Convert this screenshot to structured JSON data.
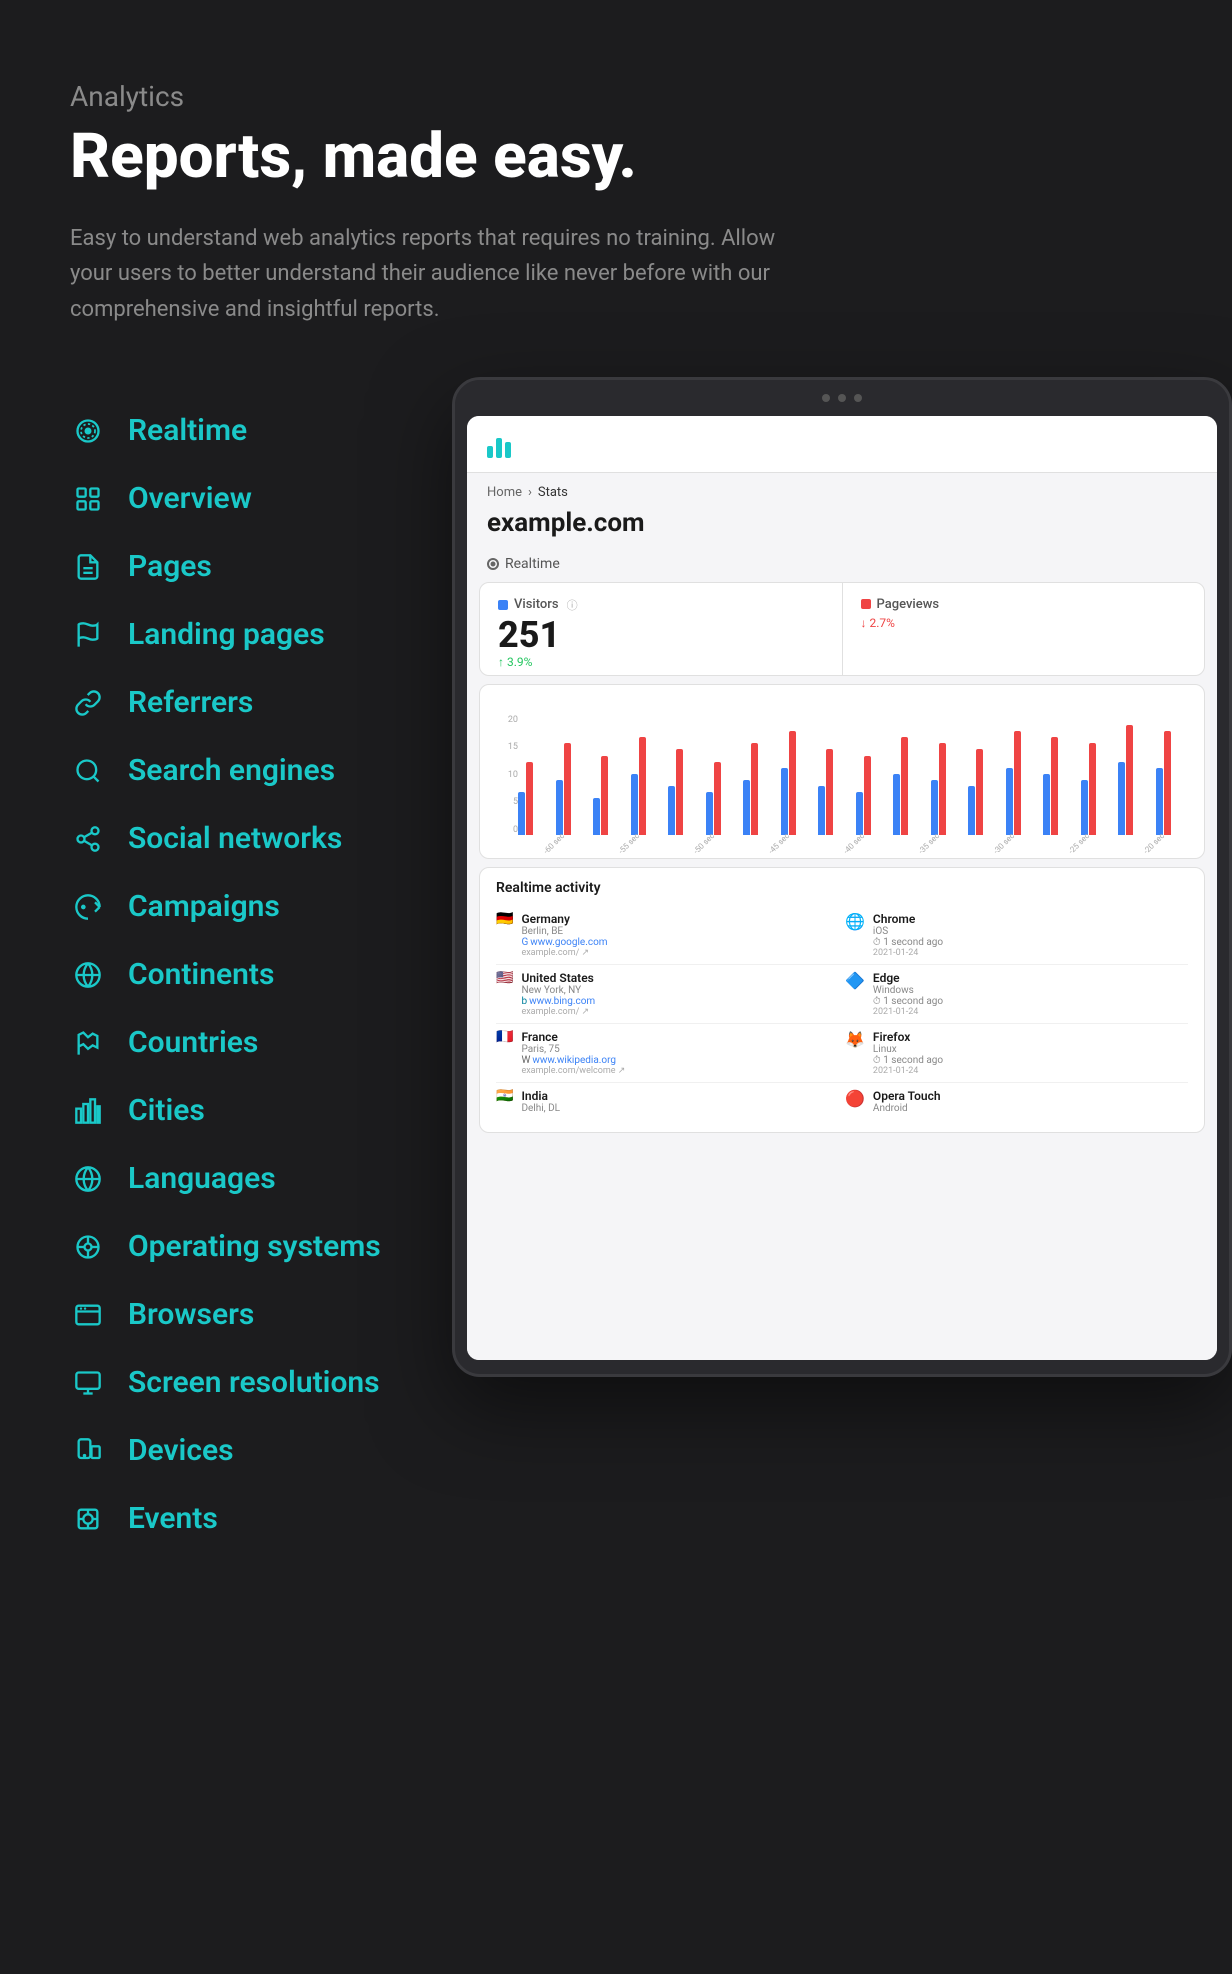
{
  "page": {
    "background": "#1c1c1e"
  },
  "header": {
    "analytics_label": "Analytics",
    "main_title": "Reports, made easy.",
    "description": "Easy to understand web analytics reports that requires no training. Allow your users to better understand their audience like never before with our comprehensive and insightful reports."
  },
  "nav": {
    "items": [
      {
        "id": "realtime",
        "label": "Realtime",
        "icon": "realtime-icon"
      },
      {
        "id": "overview",
        "label": "Overview",
        "icon": "overview-icon"
      },
      {
        "id": "pages",
        "label": "Pages",
        "icon": "pages-icon"
      },
      {
        "id": "landing-pages",
        "label": "Landing pages",
        "icon": "landing-pages-icon"
      },
      {
        "id": "referrers",
        "label": "Referrers",
        "icon": "referrers-icon"
      },
      {
        "id": "search-engines",
        "label": "Search engines",
        "icon": "search-engines-icon"
      },
      {
        "id": "social-networks",
        "label": "Social networks",
        "icon": "social-networks-icon"
      },
      {
        "id": "campaigns",
        "label": "Campaigns",
        "icon": "campaigns-icon"
      },
      {
        "id": "continents",
        "label": "Continents",
        "icon": "continents-icon"
      },
      {
        "id": "countries",
        "label": "Countries",
        "icon": "countries-icon"
      },
      {
        "id": "cities",
        "label": "Cities",
        "icon": "cities-icon"
      },
      {
        "id": "languages",
        "label": "Languages",
        "icon": "languages-icon"
      },
      {
        "id": "operating-systems",
        "label": "Operating systems",
        "icon": "os-icon"
      },
      {
        "id": "browsers",
        "label": "Browsers",
        "icon": "browsers-icon"
      },
      {
        "id": "screen-resolutions",
        "label": "Screen resolutions",
        "icon": "screen-icon"
      },
      {
        "id": "devices",
        "label": "Devices",
        "icon": "devices-icon"
      },
      {
        "id": "events",
        "label": "Events",
        "icon": "events-icon"
      }
    ]
  },
  "dashboard": {
    "breadcrumb_home": "Home",
    "breadcrumb_stats": "Stats",
    "site": "example.com",
    "realtime_tab": "Realtime",
    "visitors_label": "Visitors",
    "visitors_value": "251",
    "visitors_change": "3.9%",
    "visitors_change_dir": "up",
    "pageviews_label": "Pageviews",
    "pageviews_change": "2.7%",
    "pageviews_change_dir": "down",
    "activity_title": "Realtime activity",
    "chart": {
      "y_labels": [
        "20",
        "15",
        "10",
        "5",
        "0"
      ],
      "x_labels": [
        "-60 sec",
        "-55 sec",
        "-50 sec",
        "-45 sec",
        "-40 sec",
        "-35 sec",
        "-30 sec",
        "-25 sec",
        "-20 sec"
      ],
      "bars": [
        {
          "visitors": 35,
          "pageviews": 60
        },
        {
          "visitors": 45,
          "pageviews": 75
        },
        {
          "visitors": 30,
          "pageviews": 65
        },
        {
          "visitors": 50,
          "pageviews": 80
        },
        {
          "visitors": 40,
          "pageviews": 70
        },
        {
          "visitors": 35,
          "pageviews": 60
        },
        {
          "visitors": 45,
          "pageviews": 75
        },
        {
          "visitors": 55,
          "pageviews": 85
        },
        {
          "visitors": 40,
          "pageviews": 70
        },
        {
          "visitors": 35,
          "pageviews": 65
        },
        {
          "visitors": 50,
          "pageviews": 80
        },
        {
          "visitors": 45,
          "pageviews": 75
        },
        {
          "visitors": 40,
          "pageviews": 70
        },
        {
          "visitors": 55,
          "pageviews": 85
        },
        {
          "visitors": 50,
          "pageviews": 80
        },
        {
          "visitors": 45,
          "pageviews": 75
        },
        {
          "visitors": 60,
          "pageviews": 90
        },
        {
          "visitors": 55,
          "pageviews": 85
        }
      ]
    },
    "activity_rows": [
      {
        "flag": "🇩🇪",
        "country": "Germany",
        "sub": "Berlin, BE",
        "referrer": "www.google.com",
        "referrer_path": "example.com/",
        "browser_icon": "🌐",
        "browser": "Chrome",
        "browser_sub": "iOS",
        "time": "1 second ago",
        "date": "2021-01-24"
      },
      {
        "flag": "🇺🇸",
        "country": "United States",
        "sub": "New York, NY",
        "referrer": "www.bing.com",
        "referrer_path": "example.com/",
        "browser_icon": "🔷",
        "browser": "Edge",
        "browser_sub": "Windows",
        "time": "1 second ago",
        "date": "2021-01-24"
      },
      {
        "flag": "🇫🇷",
        "country": "France",
        "sub": "Paris, 75",
        "referrer": "www.wikipedia.org",
        "referrer_path": "example.com/welcome",
        "browser_icon": "🦊",
        "browser": "Firefox",
        "browser_sub": "Linux",
        "time": "1 second ago",
        "date": "2021-01-24"
      },
      {
        "flag": "🇮🇳",
        "country": "India",
        "sub": "Delhi, DL",
        "referrer": "",
        "referrer_path": "",
        "browser_icon": "🔴",
        "browser": "Opera Touch",
        "browser_sub": "Android",
        "time": "",
        "date": ""
      }
    ]
  }
}
